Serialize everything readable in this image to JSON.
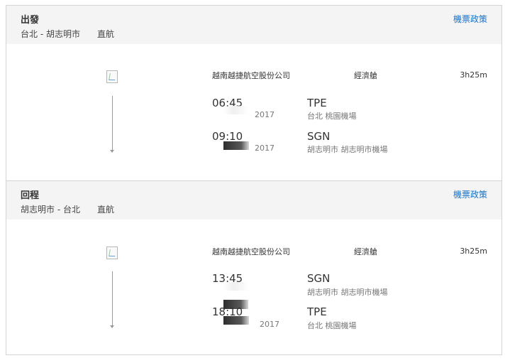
{
  "policy_label": "機票政策",
  "outbound": {
    "title": "出發",
    "route": "台北 - 胡志明市",
    "flight_type": "直航",
    "airline": "越南越捷航空股份公司",
    "cabin": "經濟艙",
    "duration": "3h25m",
    "departure": {
      "time": "06:45",
      "date_suffix": "2017",
      "code": "TPE",
      "airport": "台北 桃園機場"
    },
    "arrival": {
      "time": "09:10",
      "date_suffix": "2017",
      "code": "SGN",
      "airport": "胡志明市 胡志明市機場"
    }
  },
  "return": {
    "title": "回程",
    "route": "胡志明市 - 台北",
    "flight_type": "直航",
    "airline": "越南越捷航空股份公司",
    "cabin": "經濟艙",
    "duration": "3h25m",
    "departure": {
      "time": "13:45",
      "date_suffix": "",
      "code": "SGN",
      "airport": "胡志明市 胡志明市機場"
    },
    "arrival": {
      "time": "18:10",
      "date_suffix": "2017",
      "code": "TPE",
      "airport": "台北 桃園機場"
    }
  }
}
